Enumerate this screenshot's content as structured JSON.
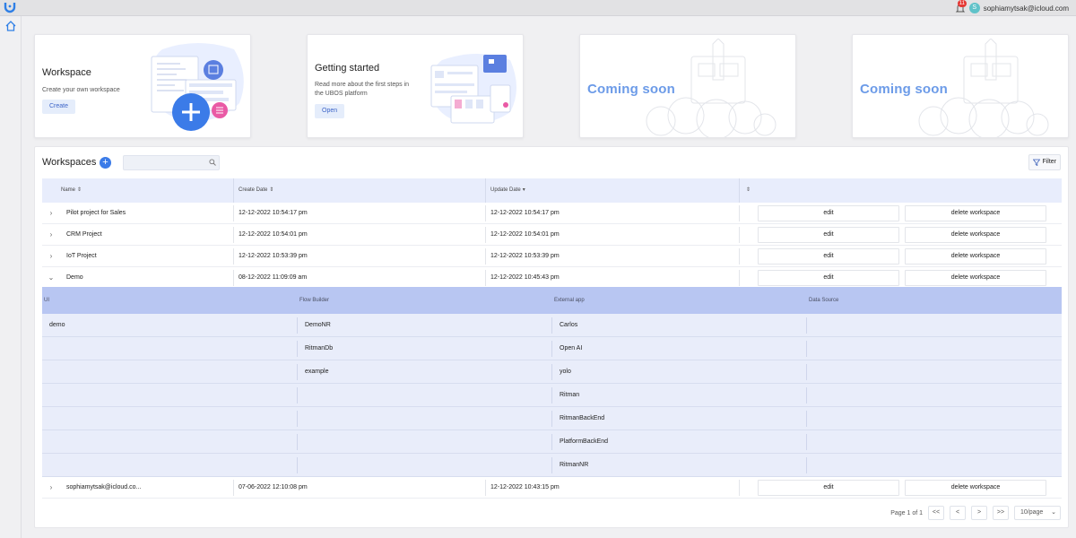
{
  "header": {
    "notification_count": "11",
    "avatar_letter": "S",
    "user_email": "sophiamytsak@icloud.com"
  },
  "cards": {
    "workspace": {
      "title": "Workspace",
      "desc": "Create your own workspace",
      "button": "Create"
    },
    "getting_started": {
      "title": "Getting started",
      "desc_line1": "Read more about the first steps in",
      "desc_line2": "the UBOS platform",
      "button": "Open"
    },
    "coming_soon_1": {
      "title": "Coming soon"
    },
    "coming_soon_2": {
      "title": "Coming soon"
    }
  },
  "workspaces": {
    "title": "Workspaces",
    "add_label": "+",
    "search_placeholder": "",
    "filter_label": "Filter",
    "columns": {
      "name": "Name",
      "create_date": "Create Date",
      "update_date": "Update Date"
    },
    "edit_label": "edit",
    "delete_label": "delete workspace",
    "rows": [
      {
        "name": "Pilot project for Sales",
        "create": "12-12-2022 10:54:17 pm",
        "update": "12-12-2022 10:54:17 pm",
        "chev": "›"
      },
      {
        "name": "CRM Project",
        "create": "12-12-2022 10:54:01 pm",
        "update": "12-12-2022 10:54:01 pm",
        "chev": "›"
      },
      {
        "name": "IoT Project",
        "create": "12-12-2022 10:53:39 pm",
        "update": "12-12-2022 10:53:39 pm",
        "chev": "›"
      },
      {
        "name": "Demo",
        "create": "08-12-2022 11:09:09 am",
        "update": "12-12-2022 10:45:43 pm",
        "chev": "⌄"
      },
      {
        "name": "sophiamytsak@icloud.co...",
        "create": "07-06-2022 12:10:08 pm",
        "update": "12-12-2022 10:43:15 pm",
        "chev": "›"
      }
    ],
    "expanded": {
      "headers": {
        "ui": "UI",
        "flow": "Flow Builder",
        "external": "External app",
        "data": "Data Source"
      },
      "rows": [
        {
          "ui": "demo",
          "flow": "DemoNR",
          "external": "Carlos",
          "data": ""
        },
        {
          "ui": "",
          "flow": "RitmanDb",
          "external": "Open AI",
          "data": ""
        },
        {
          "ui": "",
          "flow": "example",
          "external": "yolo",
          "data": ""
        },
        {
          "ui": "",
          "flow": "",
          "external": "Ritman",
          "data": ""
        },
        {
          "ui": "",
          "flow": "",
          "external": "RitmanBackEnd",
          "data": ""
        },
        {
          "ui": "",
          "flow": "",
          "external": "PlatformBackEnd",
          "data": ""
        },
        {
          "ui": "",
          "flow": "",
          "external": "RitmanNR",
          "data": ""
        }
      ]
    },
    "pagination": {
      "page_info": "Page 1 of 1",
      "first": "<<",
      "prev": "<",
      "next": ">",
      "last": ">>",
      "page_size": "10/page"
    }
  },
  "colors": {
    "accent": "#3b7be8",
    "table_header": "#e8edfc",
    "sub_header": "#b8c6f2",
    "sub_row": "#e9edfa",
    "coming_soon": "#6c9be8"
  }
}
